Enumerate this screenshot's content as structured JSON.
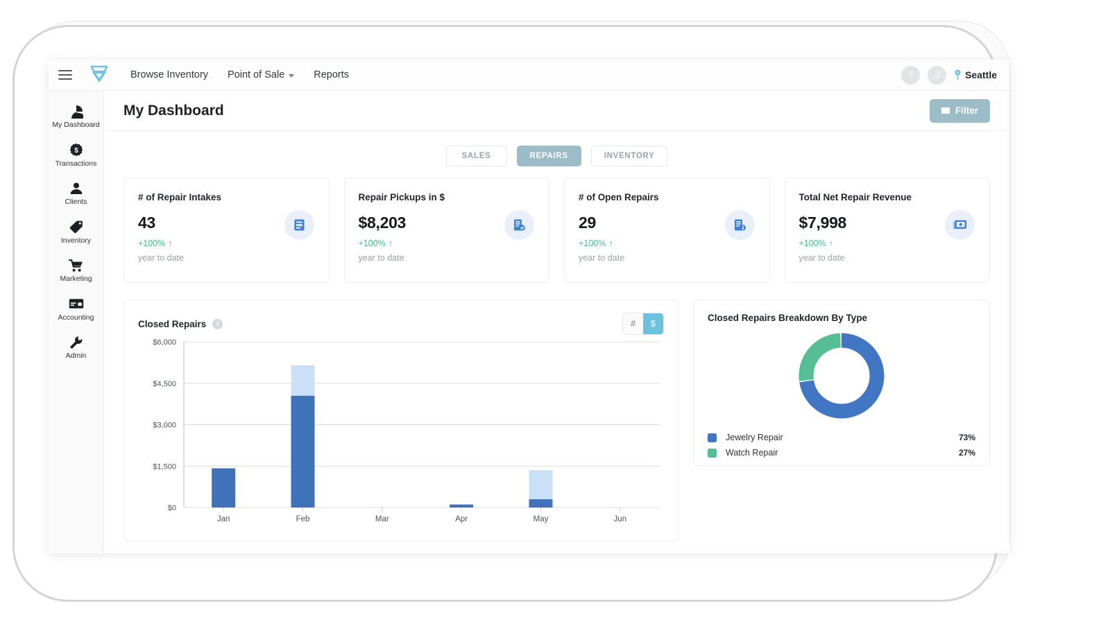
{
  "app": {
    "logo_name": "diamond-logo",
    "brand_accent": "#6cc2de"
  },
  "topnav": {
    "menu_label": "menu",
    "links": [
      {
        "label": "Browse Inventory",
        "has_caret": false
      },
      {
        "label": "Point of Sale",
        "has_caret": true
      },
      {
        "label": "Reports",
        "has_caret": false
      }
    ],
    "help_label": "?",
    "user_initial": "J",
    "location": "Seattle"
  },
  "sidebar": {
    "items": [
      {
        "label": "My Dashboard",
        "icon": "pie-chart-icon"
      },
      {
        "label": "Transactions",
        "icon": "dollar-coin-icon"
      },
      {
        "label": "Clients",
        "icon": "person-icon"
      },
      {
        "label": "Inventory",
        "icon": "tag-icon"
      },
      {
        "label": "Marketing",
        "icon": "shopping-cart-icon"
      },
      {
        "label": "Accounting",
        "icon": "card-icon"
      },
      {
        "label": "Admin",
        "icon": "wrench-icon"
      }
    ]
  },
  "page": {
    "title": "My Dashboard",
    "filter_label": "Filter",
    "filter_color": "#9cbcc8"
  },
  "tabs": [
    {
      "label": "SALES",
      "active": false
    },
    {
      "label": "REPAIRS",
      "active": true
    },
    {
      "label": "INVENTORY",
      "active": false
    }
  ],
  "kpis": [
    {
      "title": "# of Repair Intakes",
      "value": "43",
      "delta": "+100%",
      "delta_arrow": "↑",
      "sub": "year to date",
      "icon": "repair-intake-doc-icon"
    },
    {
      "title": "Repair Pickups in $",
      "value": "$8,203",
      "delta": "+100%",
      "delta_arrow": "↑",
      "sub": "year to date",
      "icon": "doc-check-icon"
    },
    {
      "title": "# of Open Repairs",
      "value": "29",
      "delta": "+100%",
      "delta_arrow": "↑",
      "sub": "year to date",
      "icon": "doc-info-icon"
    },
    {
      "title": "Total Net Repair Revenue",
      "value": "$7,998",
      "delta": "+100%",
      "delta_arrow": "↑",
      "sub": "year to date",
      "icon": "cash-icon"
    }
  ],
  "bar_panel": {
    "title": "Closed Repairs",
    "info_tooltip": "i",
    "unit_toggle": [
      {
        "label": "#",
        "active": false
      },
      {
        "label": "$",
        "active": true
      }
    ]
  },
  "donut_panel": {
    "title": "Closed Repairs Breakdown By Type"
  },
  "chart_data": [
    {
      "type": "bar",
      "id": "closed-repairs-bar",
      "title": "Closed Repairs",
      "stacked": true,
      "xlabel": "",
      "ylabel": "",
      "ylim": [
        0,
        6000
      ],
      "yticks": [
        0,
        1500,
        3000,
        4500,
        6000
      ],
      "ytick_labels": [
        "$0",
        "$1,500",
        "$3,000",
        "$4,500",
        "$6,000"
      ],
      "grid": true,
      "categories": [
        "Jan",
        "Feb",
        "Mar",
        "Apr",
        "May",
        "Jun"
      ],
      "series": [
        {
          "name": "primary",
          "color": "#3f72b9",
          "values": [
            1420,
            4050,
            0,
            110,
            300,
            0
          ]
        },
        {
          "name": "secondary",
          "color": "#c9e0f7",
          "values": [
            0,
            1100,
            0,
            0,
            1050,
            0
          ]
        }
      ]
    },
    {
      "type": "pie",
      "id": "closed-repairs-breakdown",
      "title": "Closed Repairs Breakdown By Type",
      "donut": true,
      "legend": "bottom",
      "slices": [
        {
          "label": "Jewelry Repair",
          "value": 73,
          "pct_label": "73%",
          "color": "#4176c2"
        },
        {
          "label": "Watch Repair",
          "value": 27,
          "pct_label": "27%",
          "color": "#56be94"
        }
      ]
    }
  ]
}
